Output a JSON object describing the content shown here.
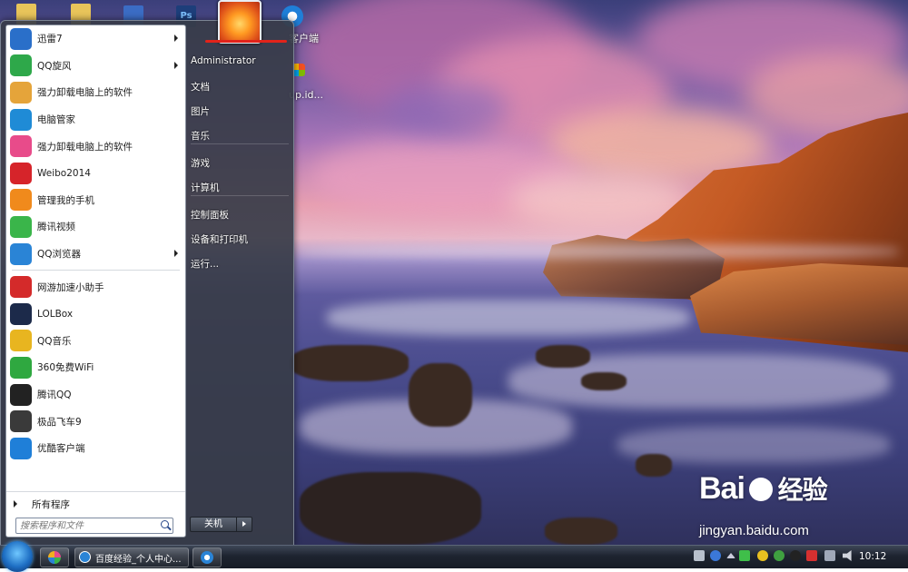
{
  "start_menu": {
    "programs": [
      {
        "label": "迅雷7",
        "icon": "xunlei-icon",
        "color": "#2a6fc9",
        "has_submenu": true
      },
      {
        "label": "QQ旋风",
        "icon": "qq-xuanfeng-icon",
        "color": "#2ea84a",
        "has_submenu": true
      },
      {
        "label": "强力卸载电脑上的软件",
        "icon": "uninstall-box-icon",
        "color": "#e5a43a",
        "has_submenu": false
      },
      {
        "label": "电脑管家",
        "icon": "pc-manager-shield-icon",
        "color": "#1f8bd6",
        "has_submenu": false
      },
      {
        "label": "强力卸载电脑上的软件",
        "icon": "pinwheel-icon",
        "color": "#e84b8a",
        "has_submenu": false
      },
      {
        "label": "Weibo2014",
        "icon": "weibo-icon",
        "color": "#d6242a",
        "has_submenu": false
      },
      {
        "label": "管理我的手机",
        "icon": "phone-manager-icon",
        "color": "#f08a1c",
        "has_submenu": false
      },
      {
        "label": "腾讯视频",
        "icon": "tencent-video-icon",
        "color": "#3ab54a",
        "has_submenu": false
      },
      {
        "label": "QQ浏览器",
        "icon": "qq-browser-icon",
        "color": "#2a84d6",
        "has_submenu": true
      },
      {
        "label": "网游加速小助手",
        "icon": "game-accelerator-icon",
        "color": "#d42a2a",
        "has_submenu": false
      },
      {
        "label": "LOLBox",
        "icon": "lolbox-icon",
        "color": "#1c2a4a",
        "has_submenu": false
      },
      {
        "label": "QQ音乐",
        "icon": "qq-music-icon",
        "color": "#e8b520",
        "has_submenu": false
      },
      {
        "label": "360免费WiFi",
        "icon": "wifi-icon",
        "color": "#2fa840",
        "has_submenu": false
      },
      {
        "label": "腾讯QQ",
        "icon": "qq-penguin-icon",
        "color": "#222222",
        "has_submenu": false
      },
      {
        "label": "极品飞车9",
        "icon": "nfs-mw-icon",
        "color": "#3a3a3a",
        "has_submenu": false
      },
      {
        "label": "优酷客户端",
        "icon": "youku-icon",
        "color": "#1f7fd8",
        "has_submenu": false
      }
    ],
    "all_programs_label": "所有程序",
    "search_placeholder": "搜索程序和文件",
    "right_items": [
      {
        "label": "Administrator",
        "name": "user-folder"
      },
      {
        "label": "文档",
        "name": "documents"
      },
      {
        "label": "图片",
        "name": "pictures"
      },
      {
        "label": "音乐",
        "name": "music"
      },
      {
        "label": "游戏",
        "name": "games"
      },
      {
        "label": "计算机",
        "name": "computer"
      },
      {
        "label": "控制面板",
        "name": "control-panel"
      },
      {
        "label": "设备和打印机",
        "name": "devices-printers"
      },
      {
        "label": "运行...",
        "name": "run"
      }
    ],
    "shutdown_label": "关机"
  },
  "desktop": {
    "label_partial_1": "客户端",
    "label_partial_2": "up.id..."
  },
  "taskbar": {
    "window_title": "百度经验_个人中心...",
    "clock": "10:12"
  },
  "watermark": {
    "brand": "Bai",
    "brand_cn": "经验",
    "url": "jingyan.baidu.com"
  }
}
